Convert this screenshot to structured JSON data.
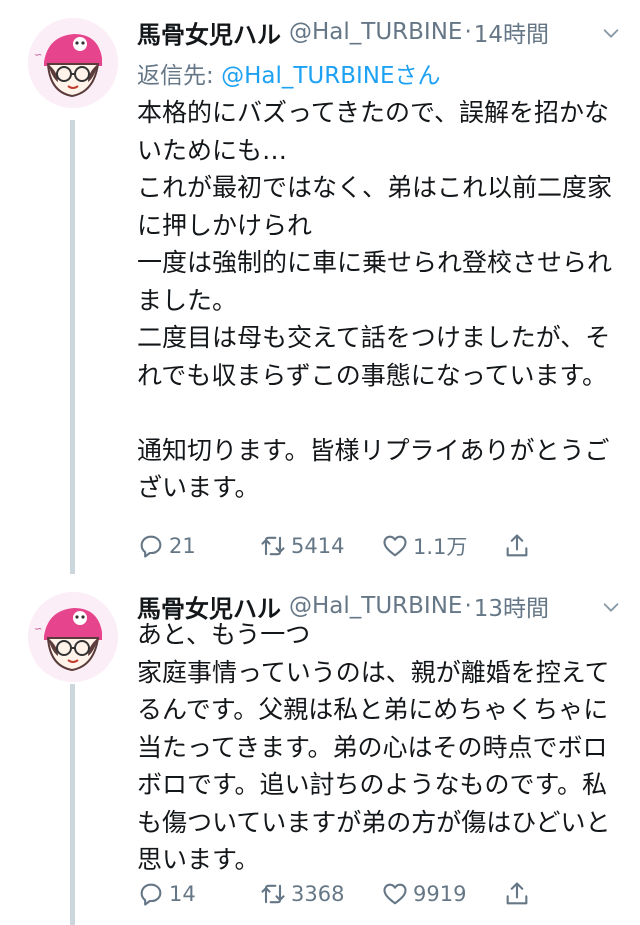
{
  "tweets": [
    {
      "display_name": "馬骨女児ハル",
      "handle": "@Hal_TURBINE",
      "dot": "·",
      "time": "14時間",
      "reply_prefix": "返信先: ",
      "reply_handle": "@Hal_TURBINEさん",
      "text": "本格的にバズってきたので、誤解を招かないためにも…\nこれが最初ではなく、弟はこれ以前二度家に押しかけられ\n一度は強制的に車に乗せられ登校させられました。\n二度目は母も交えて話をつけましたが、それでも収まらずこの事態になっています。\n\n通知切ります。皆様リプライありがとうございます。",
      "replies": "21",
      "retweets": "5414",
      "likes": "1.1万"
    },
    {
      "display_name": "馬骨女児ハル",
      "handle": "@Hal_TURBINE",
      "dot": "·",
      "time": "13時間",
      "text": "あと、もう一つ\n家庭事情っていうのは、親が離婚を控えてるんです。父親は私と弟にめちゃくちゃに当たってきます。弟の心はその時点でボロボロです。追い討ちのようなものです。私も傷ついていますが弟の方が傷はひどいと思います。",
      "replies": "14",
      "retweets": "3368",
      "likes": "9919"
    }
  ],
  "icons": {
    "reply": "reply-icon",
    "retweet": "retweet-icon",
    "like": "heart-icon",
    "share": "share-icon",
    "more": "chevron-down-icon"
  },
  "colors": {
    "text": "#14171a",
    "secondary": "#657786",
    "link": "#1da1f2",
    "thread_line": "#ccd6dd",
    "avatar_bg": "#fbeef6",
    "avatar_accent": "#e6458e"
  }
}
